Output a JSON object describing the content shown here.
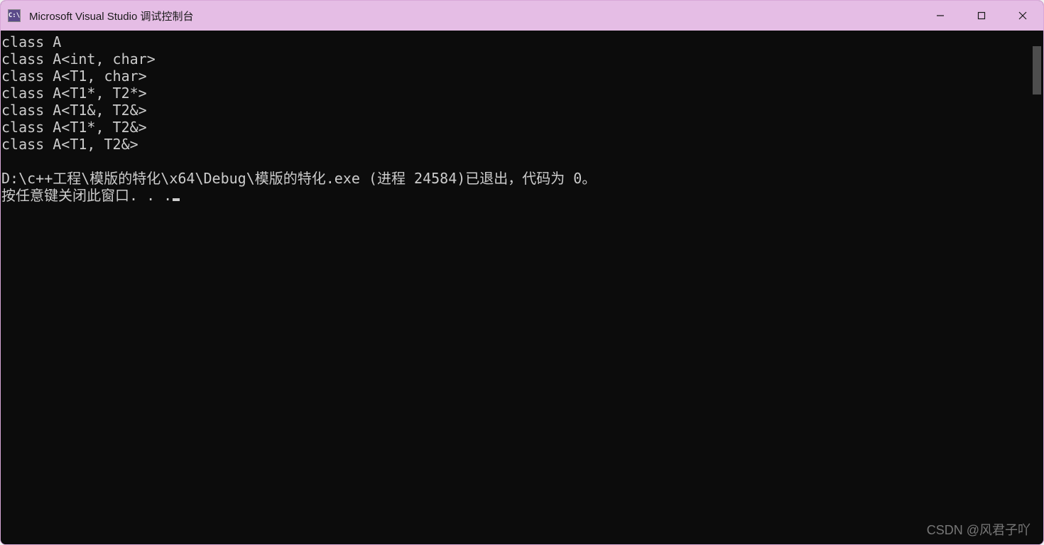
{
  "window": {
    "icon_label": "C:\\",
    "title": "Microsoft Visual Studio 调试控制台"
  },
  "console": {
    "lines": [
      "class A",
      "class A<int, char>",
      "class A<T1, char>",
      "class A<T1*, T2*>",
      "class A<T1&, T2&>",
      "class A<T1*, T2&>",
      "class A<T1, T2&>",
      "",
      "D:\\c++工程\\模版的特化\\x64\\Debug\\模版的特化.exe (进程 24584)已退出，代码为 0。"
    ],
    "prompt_line": "按任意键关闭此窗口. . ."
  },
  "watermark": "CSDN @风君子吖"
}
